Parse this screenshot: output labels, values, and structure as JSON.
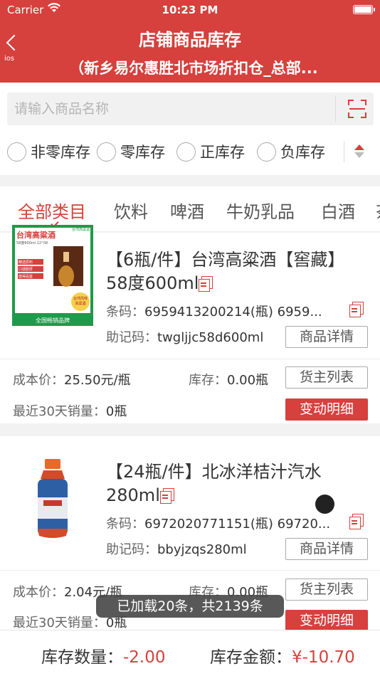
{
  "status_bar": {
    "carrier": "Carrier",
    "time": "10:23 PM"
  },
  "nav": {
    "title": "店铺商品库存",
    "subtitle": "（新乡易尔惠胜北市场折扣仓_总部...",
    "back_sublabel": "ios"
  },
  "search": {
    "placeholder": "请输入商品名称"
  },
  "stock_filters": [
    "非零库存",
    "零库存",
    "正库存",
    "负库存"
  ],
  "tabs": [
    "全部类目",
    "饮料",
    "啤酒",
    "牛奶乳品",
    "白酒",
    "茶"
  ],
  "labels": {
    "barcode": "条码：",
    "mnemonic": "助记码：",
    "cost": "成本价：",
    "stock": "库存：",
    "sales30": "最近30天销量：",
    "detail_btn": "商品详情",
    "owner_btn": "货主列表",
    "change_btn": "变动明细"
  },
  "products": [
    {
      "name": "【6瓶/件】台湾高粱酒【窖藏】58度600ml",
      "barcode": "6959413200214(瓶)  6959...",
      "mnemonic": "twgljjc58d600ml",
      "cost": "25.50元/瓶",
      "stock": "0.00瓶",
      "sales30": "0瓶",
      "image_text": {
        "title": "台湾高粱酒",
        "subtitle": "58度600ml 12°/W",
        "bullets": [
          "精选原料",
          "口感醇厚",
          "值得品鉴"
        ],
        "badge": "台湾风味高粱酒",
        "corner": "台湾高粱酒",
        "bottom": "全国畅销品牌"
      }
    },
    {
      "name": "【24瓶/件】北冰洋桔汁汽水280ml",
      "barcode": "6972020771151(瓶)  69720...",
      "mnemonic": "bbyjzqs280ml",
      "cost": "2.04元/瓶",
      "stock": "0.00瓶",
      "sales30": "0瓶"
    }
  ],
  "toast": "已加载20条，共2139条",
  "footer": {
    "qty_label": "库存数量：",
    "qty_value": "-2.00",
    "amount_label": "库存金额：",
    "amount_value": "¥-10.70"
  },
  "colors": {
    "brand": "#d6403d"
  }
}
